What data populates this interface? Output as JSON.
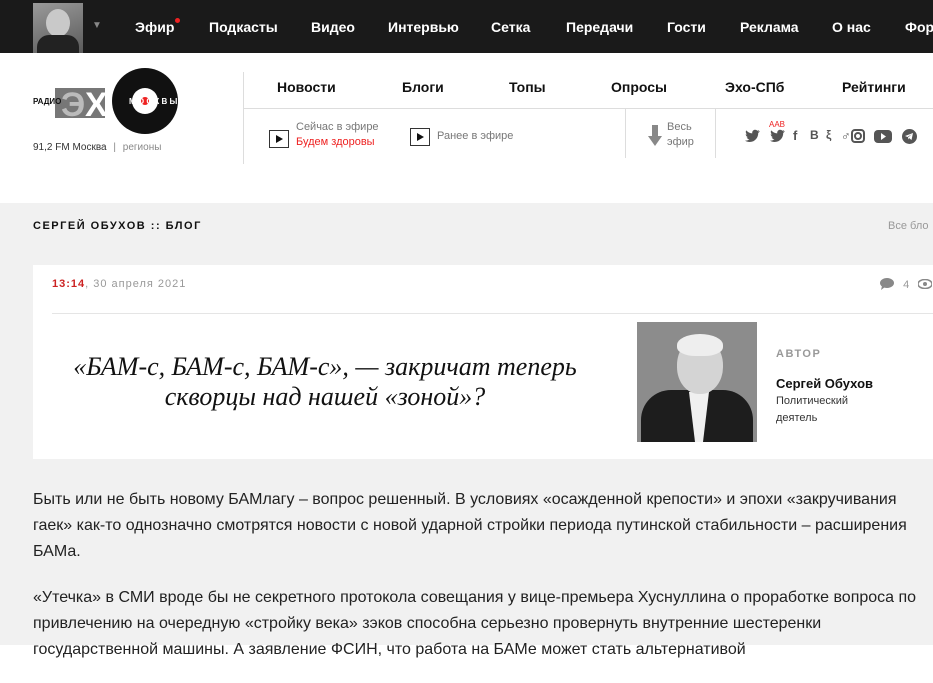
{
  "topbar": {
    "nav": [
      "Эфир",
      "Подкасты",
      "Видео",
      "Интервью",
      "Сетка",
      "Передачи",
      "Гости",
      "Реклама",
      "О нас",
      "Фор"
    ]
  },
  "logo": {
    "left_word": "РАДИО",
    "right_word": "М О С К В Ы",
    "freq": "91,2 FM Москва",
    "regions": "регионы"
  },
  "mainnav": [
    "Новости",
    "Блоги",
    "Топы",
    "Опросы",
    "Эхо-СПб",
    "Рейтинги"
  ],
  "air": {
    "now_label": "Сейчас в эфире",
    "now_show": "Будем здоровы",
    "earlier_label": "Ранее в эфире",
    "all_line1": "Весь",
    "all_line2": "эфир"
  },
  "social": {
    "aab": "AAB",
    "icons": [
      "twitter-icon",
      "twitter-aab-icon",
      "facebook-icon",
      "vk-icon",
      "livejournal-icon",
      "odnoklassniki-icon",
      "instagram-icon",
      "youtube-icon",
      "telegram-icon"
    ]
  },
  "blog": {
    "title": "СЕРГЕЙ ОБУХОВ :: БЛОГ",
    "all_blogs": "Все бло"
  },
  "post": {
    "time": "13:14",
    "date": ", 30 апреля 2021",
    "comments": "4",
    "headline": "«БАМ-с, БАМ-с, БАМ-с», — закричат теперь скворцы над нашей «зоной»?",
    "author_label": "АВТОР",
    "author_name": "Сергей Обухов",
    "author_desc": "Политический деятель"
  },
  "article": {
    "p1": "Быть или не быть новому БАМлагу – вопрос решенный. В условиях «осажденной крепости» и эпохи «закручивания гаек» как-то однозначно смотрятся новости с новой ударной стройки периода путинской стабильности – расширения БАМа.",
    "p2": "«Утечка» в СМИ вроде бы не секретного протокола совещания у вице-премьера Хуснуллина о проработке вопроса по привлечению на очередную «стройку века» зэков способна серьезно провернуть внутренние шестеренки государственной машины. А заявление ФСИН, что работа на БАМе может стать альтернативой"
  },
  "colors": {
    "accent": "#e22222",
    "topbar": "#1a1a1a",
    "section_bg": "#f1f1f1"
  }
}
